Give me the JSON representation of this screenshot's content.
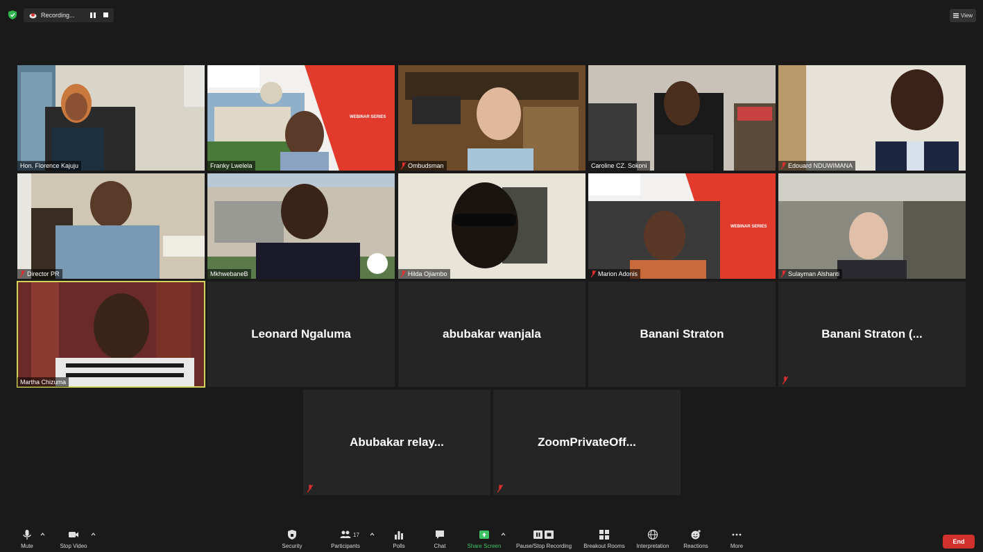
{
  "topbar": {
    "recording_label": "Recording...",
    "view_label": "View"
  },
  "colors": {
    "background": "#1a1a1a",
    "tile": "#252525",
    "active_speaker_border": "#d4d45a",
    "muted_red": "#e02f2f",
    "share_green": "#3ec264",
    "end_red": "#d0312d"
  },
  "participants_video": [
    {
      "name": "Hon. Florence Kajuju",
      "muted": false
    },
    {
      "name": "Franky Lwelela",
      "muted": false
    },
    {
      "name": "Ombudsman",
      "muted": true
    },
    {
      "name": "Caroline CZ. Sokoni",
      "muted": false
    },
    {
      "name": "Edouard NDUWIMANA",
      "muted": true
    },
    {
      "name": "Director PR",
      "muted": true
    },
    {
      "name": "MkhwebaneB",
      "muted": false
    },
    {
      "name": "Hilda Ojiambo",
      "muted": true
    },
    {
      "name": "Marion Adonis",
      "muted": true
    },
    {
      "name": "Sulayman Alshanti",
      "muted": true
    },
    {
      "name": "Martha Chizuma",
      "muted": false
    }
  ],
  "participants_no_video": [
    {
      "name": "Leonard Ngaluma",
      "muted": false
    },
    {
      "name": "abubakar wanjala",
      "muted": false
    },
    {
      "name": "Banani Straton",
      "muted": false
    },
    {
      "name": "Banani Straton (...",
      "muted": true
    },
    {
      "name": "Abubakar relay...",
      "muted": true
    },
    {
      "name": "ZoomPrivateOff...",
      "muted": true
    }
  ],
  "toolbar": {
    "mute": "Mute",
    "stop_video": "Stop Video",
    "security": "Security",
    "participants": "Participants",
    "participants_count": "17",
    "polls": "Polls",
    "chat": "Chat",
    "share_screen": "Share Screen",
    "pause_stop_recording": "Pause/Stop Recording",
    "breakout_rooms": "Breakout Rooms",
    "interpretation": "Interpretation",
    "reactions": "Reactions",
    "more": "More",
    "end": "End"
  },
  "icons": [
    "shield-icon",
    "recording-icon",
    "pause-icon",
    "stop-icon",
    "grid-view-icon",
    "microphone-icon",
    "video-camera-icon",
    "security-shield-icon",
    "participants-icon",
    "polls-icon",
    "chat-icon",
    "share-screen-icon",
    "recording-controls-icon",
    "breakout-rooms-icon",
    "globe-icon",
    "reactions-icon",
    "more-icon",
    "muted-mic-icon"
  ]
}
